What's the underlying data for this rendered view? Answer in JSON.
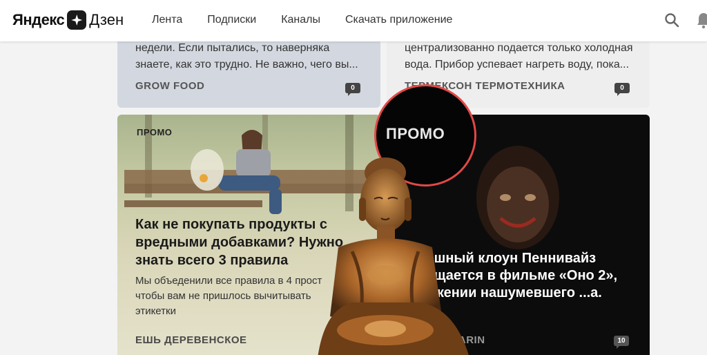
{
  "header": {
    "logo_left": "Яндекс",
    "logo_right": "Дзен",
    "nav": [
      "Лента",
      "Подписки",
      "Каналы",
      "Скачать приложение"
    ]
  },
  "cards_top": [
    {
      "snippet_line1": "недели. Если пытались, то наверняка",
      "snippet_line2": "знаете, как это трудно. Не важно, чего вы...",
      "source": "GROW FOOD",
      "comments": "0"
    },
    {
      "snippet_line1": "централизованно подается только холодная",
      "snippet_line2": "вода. Прибор успевает нагреть воду, пока...",
      "source": "ТЕРМЕКСОН ТЕРМОТЕХНИКА",
      "comments": "0"
    }
  ],
  "card_promo_left": {
    "tag": "ПРОМО",
    "title": "Как не покупать продукты с вредными добавками? Нужно знать всего 3 правила",
    "description": "Мы объеденили все правила в 4 прост чтобы вам не пришлось вычитывать этикетки",
    "source": "ЕШЬ ДЕРЕВЕНСКОЕ"
  },
  "card_promo_right": {
    "title": "...шный клоун Пеннивайз ...щается в фильме «Оно 2», ...жении нашумевшего ...а.",
    "source": "...CTARIN",
    "comments": "10"
  },
  "highlight": {
    "label": "ПРОМО"
  },
  "colors": {
    "highlight_ring": "#e34848",
    "header_bg": "#ffffff",
    "page_bg": "#f3f3f3"
  }
}
